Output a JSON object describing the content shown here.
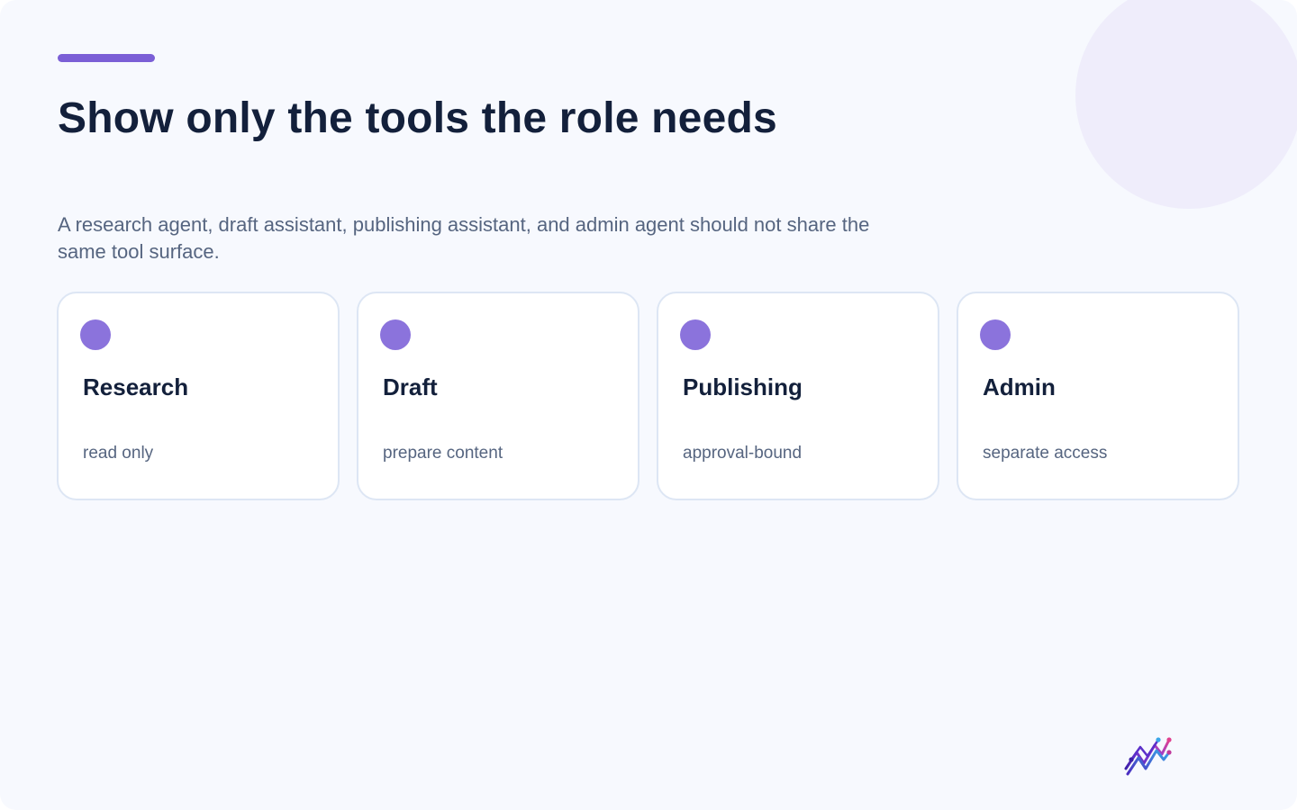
{
  "slide": {
    "title": "Show only the tools the role needs",
    "subtitle": "A research agent, draft assistant, publishing assistant, and admin agent should not share the same tool surface.",
    "cards": [
      {
        "title": "Research",
        "description": "read only"
      },
      {
        "title": "Draft",
        "description": "prepare content"
      },
      {
        "title": "Publishing",
        "description": "approval-bound"
      },
      {
        "title": "Admin",
        "description": "separate access"
      }
    ],
    "logo_icon": "zigzag-chart-logo",
    "colors": {
      "accent": "#7b5fd6",
      "card_dot": "#8b73dc",
      "title_text": "#13203b",
      "body_text": "#566580",
      "background": "#f7f9fe",
      "card_border": "#dde6f4",
      "deco_circle": "#efedfb"
    }
  }
}
